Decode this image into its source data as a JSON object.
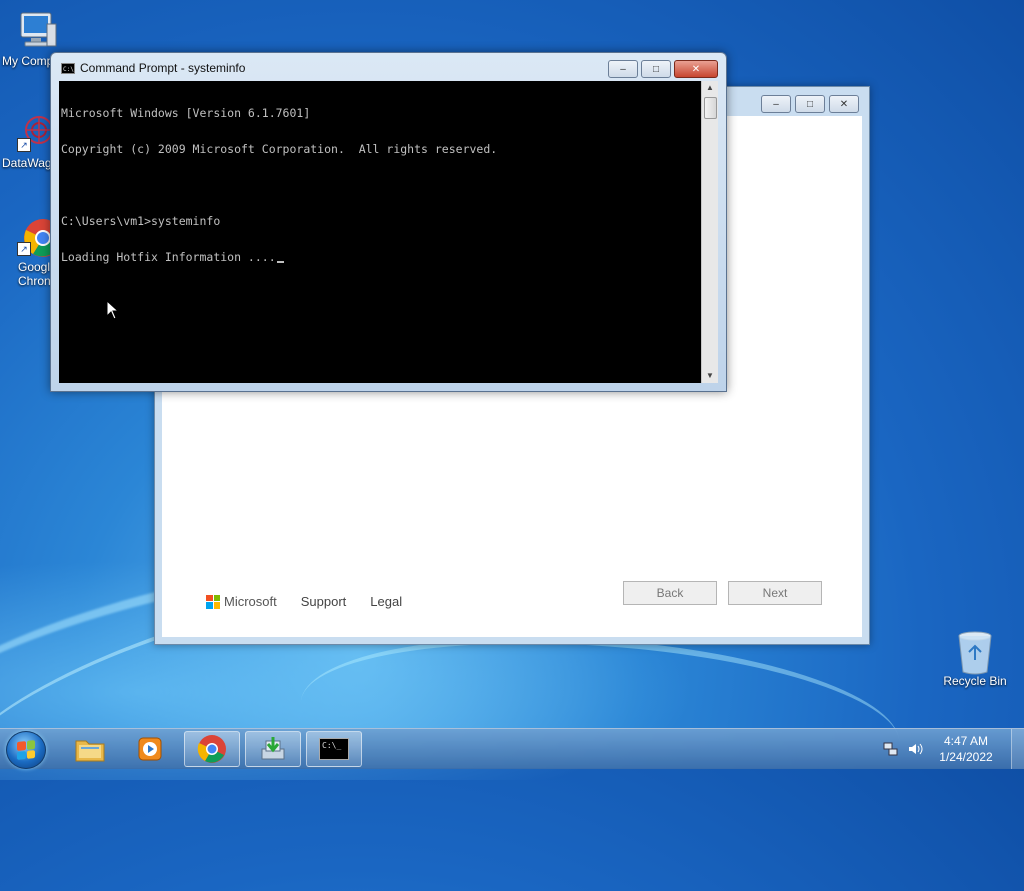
{
  "desktop": {
    "icons": [
      {
        "label": "My Comp",
        "icon": "computer-icon"
      },
      {
        "label": "DataWag",
        "icon": "datawag-icon"
      },
      {
        "label": "Googl Chron",
        "line1": "Googl",
        "line2": "Chron",
        "icon": "chrome-icon"
      },
      {
        "label": "Recycle Bin",
        "icon": "recycle-bin-icon"
      }
    ]
  },
  "cmd": {
    "title": "Command Prompt - systeminfo",
    "lines": [
      "Microsoft Windows [Version 6.1.7601]",
      "Copyright (c) 2009 Microsoft Corporation.  All rights reserved.",
      "",
      "C:\\Users\\vm1>systeminfo",
      "Loading Hotfix Information ...."
    ],
    "text_color": "#c0c0c0",
    "background": "#000000"
  },
  "setup": {
    "brand": "Microsoft",
    "support": "Support",
    "legal": "Legal",
    "back": "Back",
    "next": "Next"
  },
  "taskbar": {
    "items": [
      {
        "name": "windows-explorer",
        "icon": "folder-icon",
        "state": "pinned"
      },
      {
        "name": "media-player",
        "icon": "media-player-icon",
        "state": "pinned"
      },
      {
        "name": "google-chrome",
        "icon": "chrome-icon",
        "state": "open"
      },
      {
        "name": "setup-installer",
        "icon": "installer-icon",
        "state": "open"
      },
      {
        "name": "command-prompt",
        "icon": "cmd-icon",
        "state": "open"
      }
    ],
    "clock": {
      "time": "4:47 AM",
      "date": "1/24/2022"
    }
  },
  "colors": {
    "ms_red": "#f25022",
    "ms_green": "#7fba00",
    "ms_blue": "#00a4ef",
    "ms_yellow": "#ffb900"
  }
}
